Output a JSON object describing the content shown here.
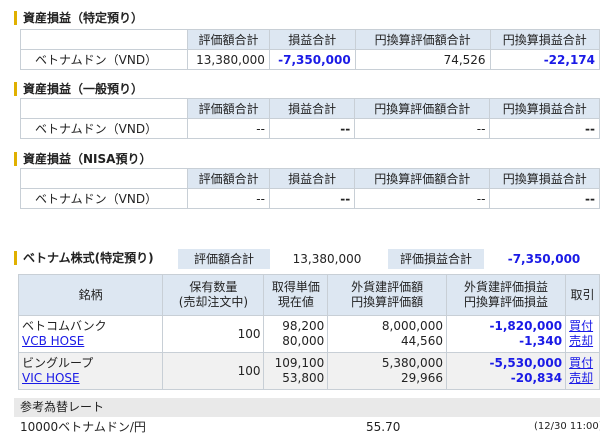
{
  "cols": [
    "評価額合計",
    "損益合計",
    "円換算評価額合計",
    "円換算損益合計"
  ],
  "sections": [
    {
      "title": "資産損益（特定預り）",
      "name": "ベトナムドン（VND）",
      "values": [
        "13,380,000",
        "-7,350,000",
        "74,526",
        "-22,174"
      ]
    },
    {
      "title": "資産損益（一般預り）",
      "name": "ベトナムドン（VND）",
      "values": [
        "--",
        "--",
        "--",
        "--"
      ]
    },
    {
      "title": "資産損益（NISA預り）",
      "name": "ベトナムドン（VND）",
      "values": [
        "--",
        "--",
        "--",
        "--"
      ]
    }
  ],
  "vstock": {
    "title": "ベトナム株式(特定預り)",
    "eval_label": "評価額合計",
    "eval_value": "13,380,000",
    "pl_label": "評価損益合計",
    "pl_value": "-7,350,000"
  },
  "stock_headers": {
    "name": "銘柄",
    "qty1": "保有数量",
    "qty2": "(売却注文中)",
    "price1": "取得単価",
    "price2": "現在値",
    "fx1": "外貨建評価額",
    "fx2": "円換算評価額",
    "pl1": "外貨建評価損益",
    "pl2": "円換算評価損益",
    "trade": "取引"
  },
  "stocks": [
    {
      "name": "ベトコムバンク",
      "code": "VCB HOSE",
      "qty": "100",
      "cost": "98,200",
      "current": "80,000",
      "fx_value": "8,000,000",
      "jpy_value": "44,560",
      "fx_pl": "-1,820,000",
      "jpy_pl": "-1,340",
      "buy": "買付",
      "sell": "売却"
    },
    {
      "name": "ビングループ",
      "code": "VIC HOSE",
      "qty": "100",
      "cost": "109,100",
      "current": "53,800",
      "fx_value": "5,380,000",
      "jpy_value": "29,966",
      "fx_pl": "-5,530,000",
      "jpy_pl": "-20,834",
      "buy": "買付",
      "sell": "売却"
    }
  ],
  "rate": {
    "title": "参考為替レート",
    "pair": "10000ベトナムドン/円",
    "value": "55.70",
    "time": "(12/30 11:00)"
  },
  "colors": {
    "negative": "#1a1ae6",
    "header_bg": "#dde7f2",
    "accent": "#e0b000"
  }
}
